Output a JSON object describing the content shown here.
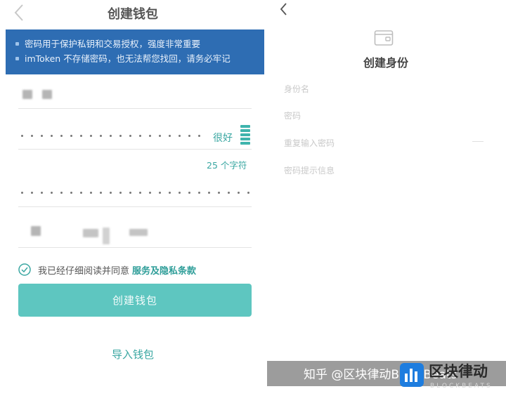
{
  "left": {
    "title": "创建钱包",
    "notice": [
      "密码用于保护私钥和交易授权，强度非常重要",
      "imToken 不存储密码，也无法帮您找回，请务必牢记"
    ],
    "password_strength": "很好",
    "char_count": "25 个字符",
    "agree_text": "我已经仔细阅读并同意",
    "agree_link": "服务及隐私条款",
    "create_button": "创建钱包",
    "import_link": "导入钱包"
  },
  "right": {
    "title": "创建身份",
    "fields": [
      "身份名",
      "密码",
      "重复输入密码",
      "密码提示信息"
    ]
  },
  "watermark": {
    "text": "知乎 @区块律动BlockBeats",
    "brand": "区块律动",
    "sub": "BLOCKBEATS"
  },
  "icons": {
    "back": "chevron-left-icon",
    "wallet": "wallet-icon",
    "check": "check-circle-icon",
    "strength": "strength-meter-icon"
  },
  "colors": {
    "accent": "#3aa7a2",
    "button": "#5ec6c0",
    "notice_bg": "#2e6db3"
  }
}
